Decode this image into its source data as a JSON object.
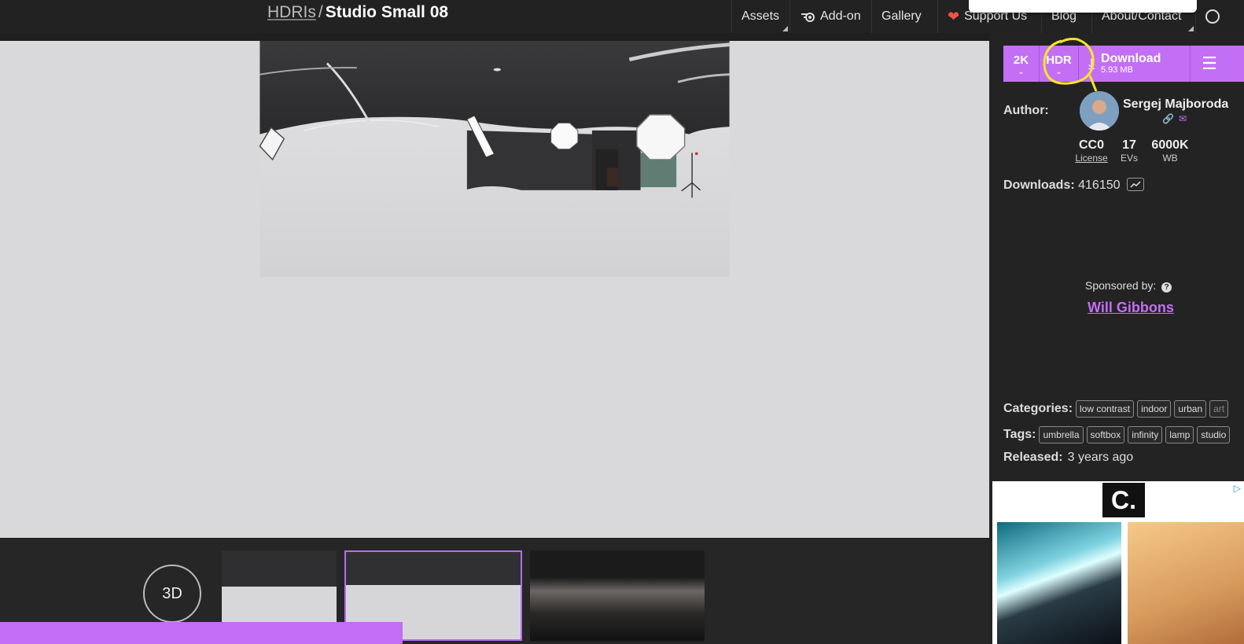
{
  "breadcrumb": {
    "root": "HDRIs",
    "separator": "/",
    "title": "Studio Small 08"
  },
  "nav": {
    "assets": "Assets",
    "addon": "Add-on",
    "gallery": "Gallery",
    "support": "Support Us",
    "blog": "Blog",
    "about": "About/Contact"
  },
  "download": {
    "resolution": "2K",
    "format": "HDR",
    "label": "Download",
    "size": "5.93 MB"
  },
  "author": {
    "label": "Author:",
    "name": "Sergej Majboroda"
  },
  "stats": [
    {
      "value": "CC0",
      "label": "License"
    },
    {
      "value": "17",
      "label": "EVs"
    },
    {
      "value": "6000K",
      "label": "WB"
    }
  ],
  "downloads": {
    "label": "Downloads:",
    "value": "416150"
  },
  "sponsor": {
    "label": "Sponsored by:",
    "help": "?",
    "name": "Will Gibbons"
  },
  "categories": {
    "label": "Categories:",
    "items": [
      "low contrast",
      "indoor",
      "urban",
      "art"
    ]
  },
  "tags": {
    "label": "Tags:",
    "items": [
      "umbrella",
      "softbox",
      "infinity",
      "lamp",
      "studio"
    ]
  },
  "released": {
    "label": "Released:",
    "value": "3 years ago"
  },
  "viewer": {
    "btn3d": "3D"
  },
  "ad": {
    "logo": "C."
  },
  "colors": {
    "accent": "#c36ff5",
    "background": "#1f1f1f",
    "annotation": "#f5e52a"
  }
}
